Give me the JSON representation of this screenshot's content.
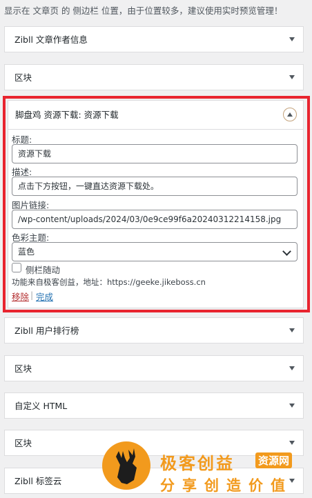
{
  "intro_text": "显示在 文章页 的 侧边栏 位置，由于位置较多，建议使用实时预览管理！",
  "widgets_top": [
    {
      "title": "Zibll 文章作者信息"
    },
    {
      "title": "区块"
    }
  ],
  "open_widget": {
    "title": "脚盘鸡 资源下载: 资源下载",
    "fields": {
      "title_label": "标题:",
      "title_value": "资源下载",
      "desc_label": "描述:",
      "desc_value": "点击下方按钮，一键直达资源下载处。",
      "image_label": "图片链接:",
      "image_value": "/wp-content/uploads/2024/03/0e9ce99f6a20240312214158.jpg",
      "color_label": "色彩主题:",
      "color_value": "蓝色",
      "follow_label": "侧栏随动",
      "follow_checked": false,
      "credit": "功能来自极客创益，地址：https://geeke.jikeboss.cn"
    },
    "actions": {
      "remove": "移除",
      "separator": "|",
      "done": "完成"
    }
  },
  "widgets_bottom": [
    {
      "title": "Zibll 用户排行榜"
    },
    {
      "title": "区块"
    },
    {
      "title": "自定义 HTML"
    },
    {
      "title": "区块"
    },
    {
      "title": "Zibll 标签云"
    }
  ],
  "watermark": {
    "brand": "极客创益",
    "badge": "资源网",
    "slogan": "分享创造价值"
  },
  "colors": {
    "highlight_border": "#e8242f",
    "remove_link": "#b32d2e",
    "done_link": "#2271b1",
    "brand_orange": "#f29a1d"
  }
}
